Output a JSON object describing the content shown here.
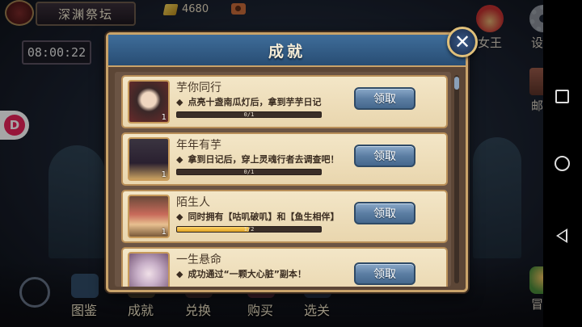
{
  "topbar": {
    "title": "深渊祭坛",
    "gold": "4680",
    "clock": "08:00:22"
  },
  "side_menu": {
    "queen_label": "女王",
    "settings_label": "设置",
    "mail_label": "邮件",
    "adventure_label": "冒险"
  },
  "bottom_menu": {
    "items": [
      "图鉴",
      "成就",
      "兑换",
      "购买",
      "选关"
    ]
  },
  "floating_button": {
    "letter": "D"
  },
  "modal": {
    "title": "成就",
    "achievements": [
      {
        "name": "芋你同行",
        "desc": "点亮十盏南瓜灯后，拿到芋芋日记",
        "progress_text": "0/1",
        "progress": 0,
        "count": "1",
        "button": "领取"
      },
      {
        "name": "年年有芋",
        "desc": "拿到日记后，穿上灵魂行者去调查吧！",
        "progress_text": "0/1",
        "progress": 0,
        "count": "1",
        "button": "领取"
      },
      {
        "name": "陌生人",
        "desc": "同时拥有【咕叽破叽】和【鱼生相伴】",
        "progress_text": "1/2",
        "progress": 0.5,
        "count": "1",
        "button": "领取"
      },
      {
        "name": "一生悬命",
        "desc": "成功通过“一颗大心脏”副本！",
        "progress_text": "",
        "progress": 0,
        "count": "",
        "button": "领取"
      }
    ]
  },
  "colors": {
    "header_blue": "#2f5a86",
    "card_bg": "#f3e6c7",
    "claim_button": "#5c7ea3",
    "progress_fill": "#f2c040",
    "brand_pink": "#e8225a"
  }
}
